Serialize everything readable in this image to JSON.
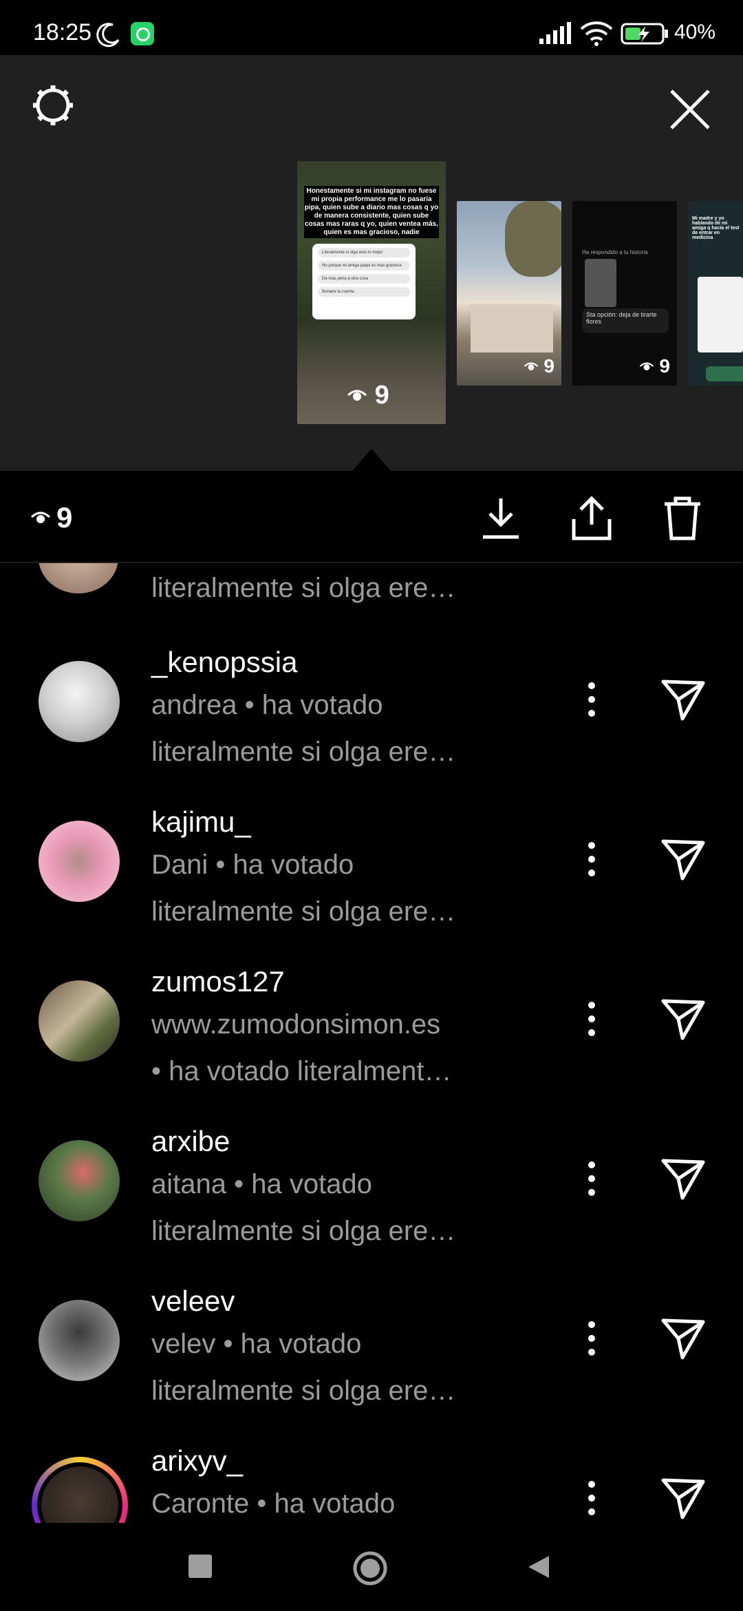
{
  "status_bar": {
    "time": "18:25",
    "battery": "40%"
  },
  "story_viewer": {
    "thumbnails": [
      {
        "caption": "Honestamente si mi instagram no fuese mi propia performance me lo pasaría pipa, quien sube a diario mas cosas q yo de manera consistente, quien sube cosas mas raras q yo, quien ventea más, quien es mas gracioso, nadie",
        "poll_options": [
          "Literalmente si olga eres lo mejor",
          "No porque mi amiga paqui es mas graciosa",
          "Da mas pena q otra cosa",
          "Bonaire la cuenta"
        ],
        "views": "9"
      },
      {
        "views": "9"
      },
      {
        "header": "Ha respondido a tu historia",
        "reply": "Sta opción: deja de tirarte flores",
        "views": "9"
      },
      {
        "caption": "Mi madre y yo hablando de mi amiga q hacía el test de entrar en medicina"
      }
    ]
  },
  "action_bar": {
    "views": "9"
  },
  "viewers": {
    "partial_subtitle": "literalmente si olga ere…",
    "items": [
      {
        "username": "_kenopssia",
        "line1": "andrea • ha votado",
        "line2": "literalmente si olga ere…"
      },
      {
        "username": "kajimu_",
        "line1": "Dani • ha votado",
        "line2": "literalmente si olga ere…"
      },
      {
        "username": "zumos127",
        "line1": "www.zumodonsimon.es",
        "line2": "• ha votado literalment…"
      },
      {
        "username": "arxibe",
        "line1": "aitana • ha votado",
        "line2": "literalmente si olga ere…"
      },
      {
        "username": "veleev",
        "line1": "velev • ha votado",
        "line2": "literalmente si olga ere…"
      },
      {
        "username": "arixyv_",
        "line1": "Caronte • ha votado",
        "line2": ""
      }
    ]
  }
}
